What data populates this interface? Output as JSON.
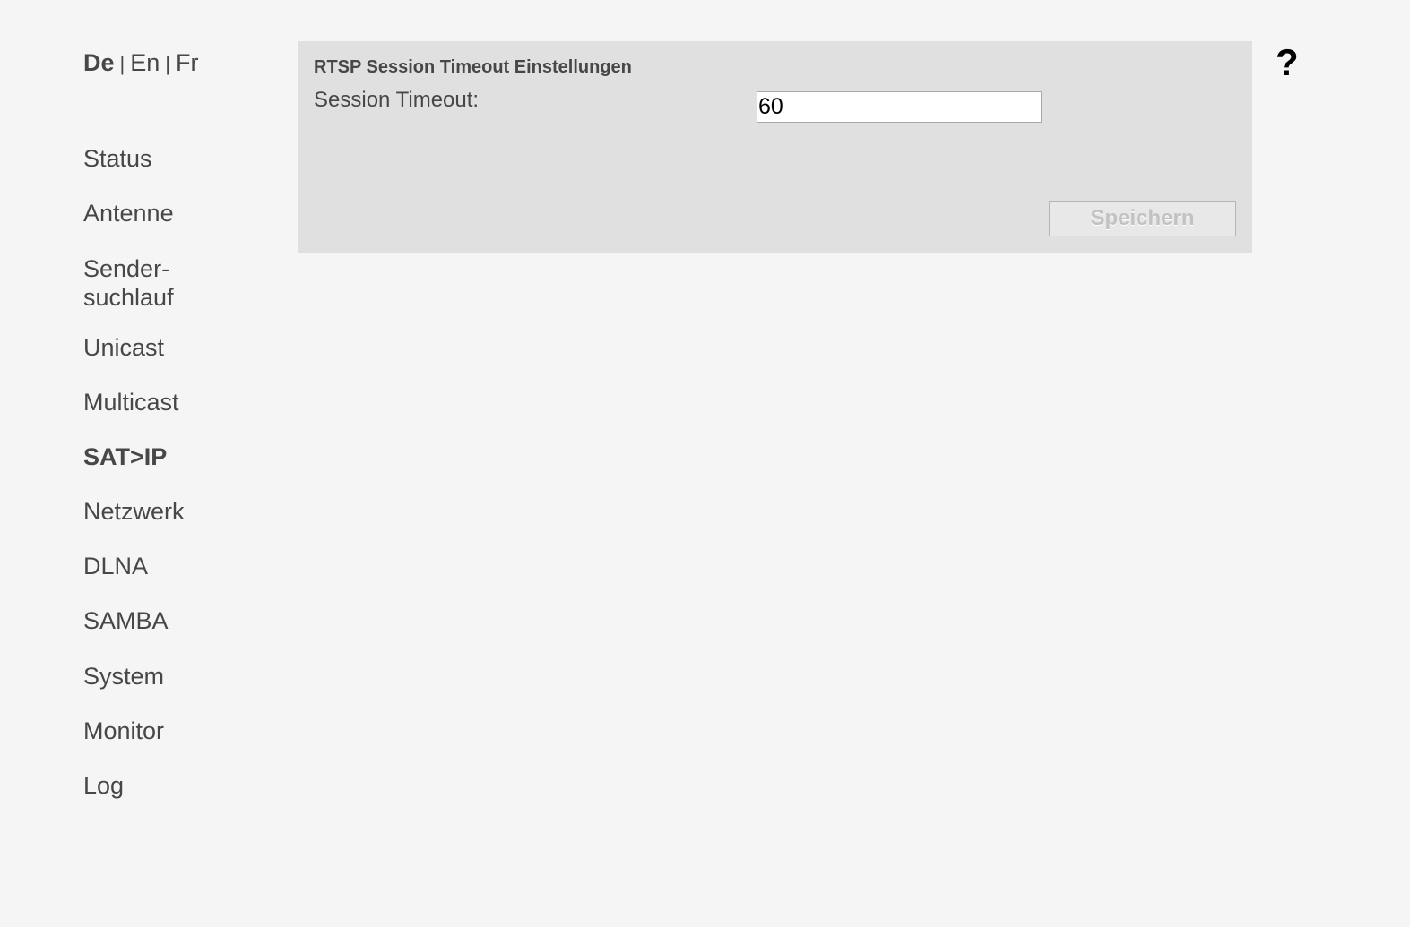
{
  "language": {
    "items": [
      "De",
      "En",
      "Fr"
    ],
    "separator": "|",
    "active": "De"
  },
  "nav": {
    "items": [
      {
        "label": "Status"
      },
      {
        "label": "Antenne"
      },
      {
        "label": "Sender-\nsuchlauf"
      },
      {
        "label": "Unicast"
      },
      {
        "label": "Multicast"
      },
      {
        "label": "SAT>IP"
      },
      {
        "label": "Netzwerk"
      },
      {
        "label": "DLNA"
      },
      {
        "label": "SAMBA"
      },
      {
        "label": "System"
      },
      {
        "label": "Monitor"
      },
      {
        "label": "Log"
      }
    ],
    "active": "SAT>IP"
  },
  "panel": {
    "title": "RTSP Session Timeout Einstellungen",
    "field_label": "Session Timeout:",
    "field_value": "60",
    "save_label": "Speichern"
  },
  "help": {
    "label": "?"
  }
}
